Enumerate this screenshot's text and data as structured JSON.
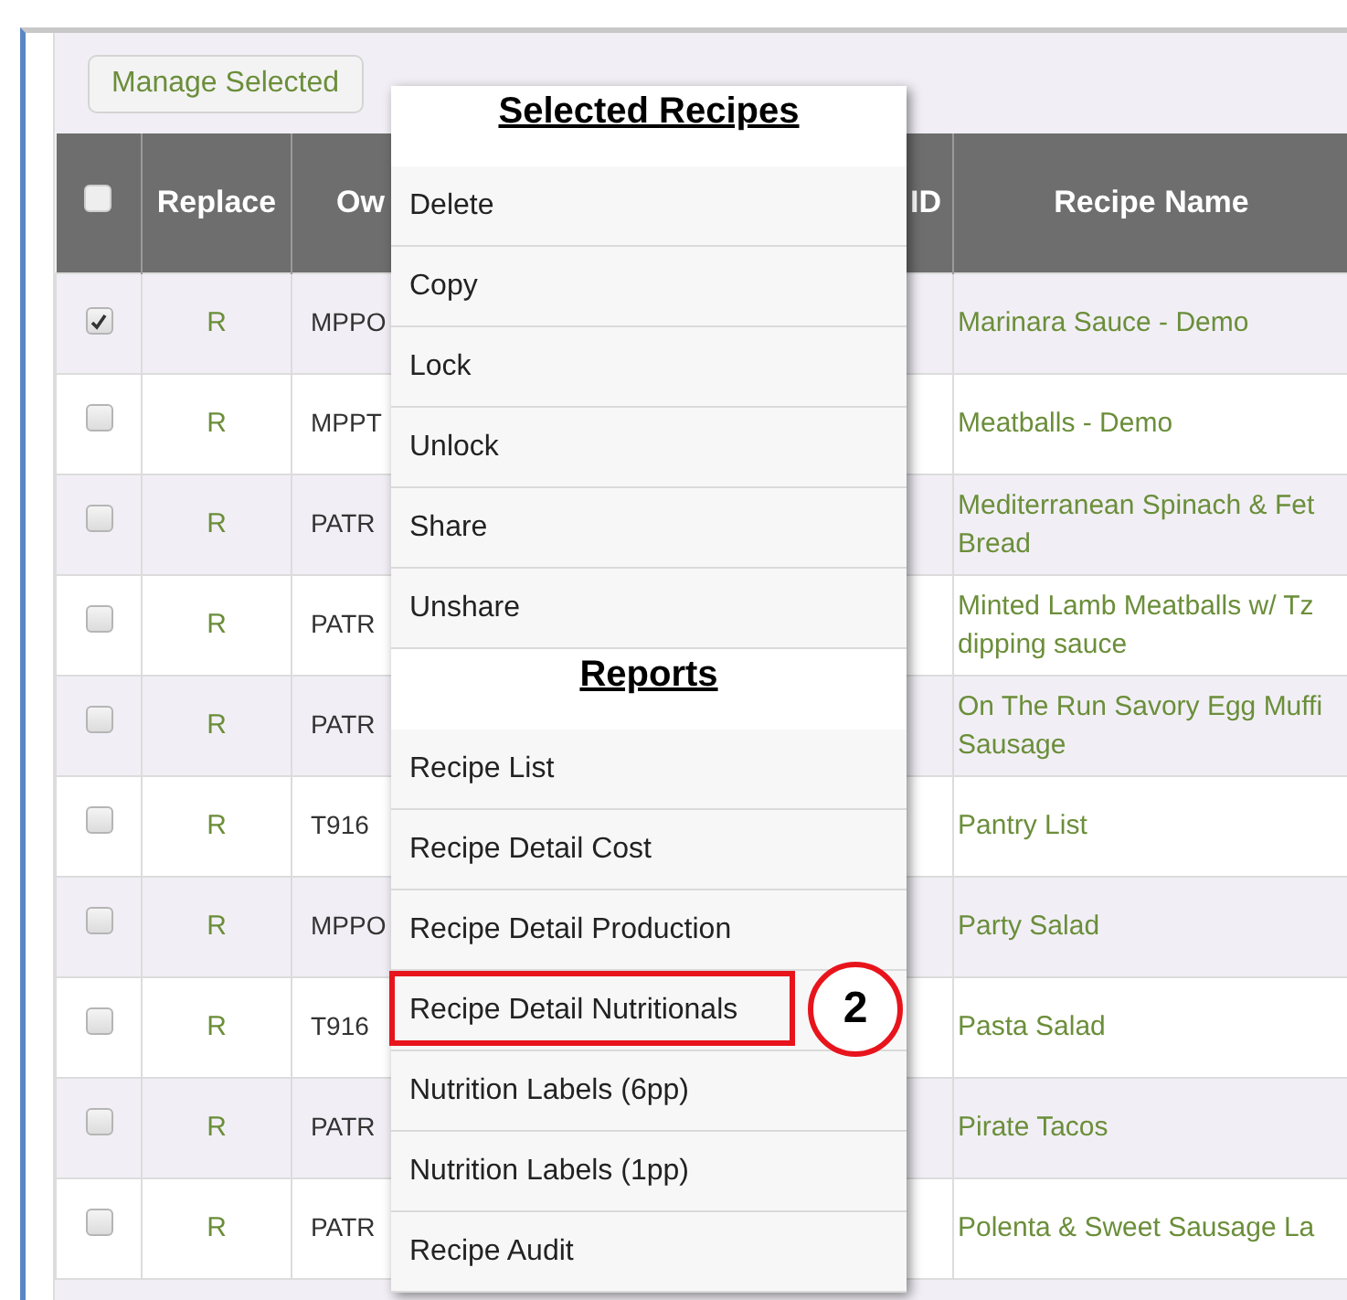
{
  "toolbar": {
    "button": "Manage Selected"
  },
  "table": {
    "columns": [
      {
        "kind": "checkbox",
        "checked": false
      },
      {
        "kind": "text",
        "label": "Replace"
      },
      {
        "kind": "text",
        "label": "Ow"
      },
      {
        "kind": "blank"
      },
      {
        "kind": "blank"
      },
      {
        "kind": "text",
        "label": "ID"
      },
      {
        "kind": "text",
        "label": "Recipe Name"
      }
    ],
    "rows": [
      {
        "checked": true,
        "replace": "R",
        "owner": "MPPO",
        "name": "Marinara Sauce - Demo"
      },
      {
        "checked": false,
        "replace": "R",
        "owner": "MPPT",
        "name": "Meatballs - Demo"
      },
      {
        "checked": false,
        "replace": "R",
        "owner": "PATR",
        "name": "Mediterranean Spinach & Fet\nBread"
      },
      {
        "checked": false,
        "replace": "R",
        "owner": "PATR",
        "name": "Minted Lamb Meatballs w/ Tz\ndipping sauce"
      },
      {
        "checked": false,
        "replace": "R",
        "owner": "PATR",
        "name": "On The Run Savory Egg Muffi\nSausage"
      },
      {
        "checked": false,
        "replace": "R",
        "owner": "T916",
        "name": "Pantry List"
      },
      {
        "checked": false,
        "replace": "R",
        "owner": "MPPO",
        "name": "Party Salad"
      },
      {
        "checked": false,
        "replace": "R",
        "owner": "T916",
        "name": "Pasta Salad"
      },
      {
        "checked": false,
        "replace": "R",
        "owner": "PATR",
        "name": "Pirate Tacos"
      },
      {
        "checked": false,
        "replace": "R",
        "owner": "PATR",
        "name": "Polenta & Sweet Sausage La"
      }
    ]
  },
  "menu": {
    "sections": [
      {
        "title": "Selected Recipes",
        "items": [
          {
            "label": "Delete",
            "highlighted": false
          },
          {
            "label": "Copy",
            "highlighted": false
          },
          {
            "label": "Lock",
            "highlighted": false
          },
          {
            "label": "Unlock",
            "highlighted": false
          },
          {
            "label": "Share",
            "highlighted": false
          },
          {
            "label": "Unshare",
            "highlighted": false
          }
        ]
      },
      {
        "title": "Reports",
        "items": [
          {
            "label": "Recipe List",
            "highlighted": false
          },
          {
            "label": "Recipe Detail Cost",
            "highlighted": false
          },
          {
            "label": "Recipe Detail Production",
            "highlighted": false
          },
          {
            "label": "Recipe Detail Nutritionals",
            "highlighted": true,
            "callout": "2"
          },
          {
            "label": "Nutrition Labels (6pp)",
            "highlighted": false
          },
          {
            "label": "Nutrition Labels (1pp)",
            "highlighted": false
          },
          {
            "label": "Recipe Audit",
            "highlighted": false
          }
        ]
      }
    ]
  }
}
